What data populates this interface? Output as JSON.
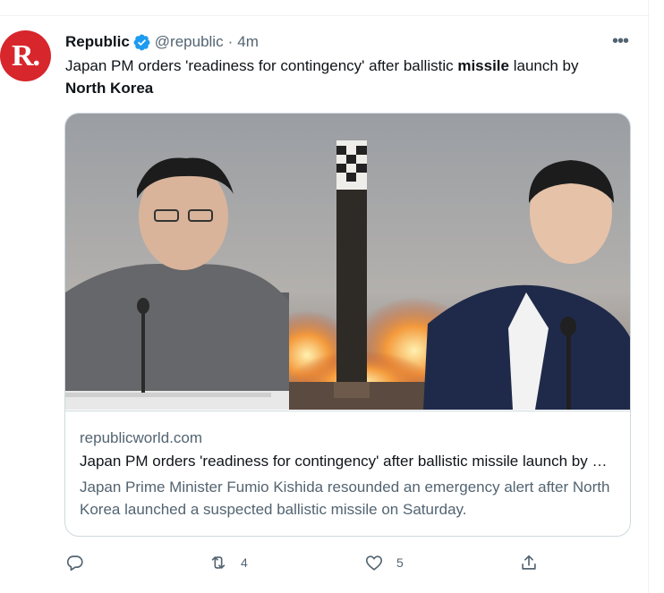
{
  "tweet": {
    "author_name": "Republic",
    "author_handle": "@republic",
    "separator": "·",
    "time": "4m",
    "avatar_letter": "R.",
    "text": {
      "part1": "Japan PM orders 'readiness for contingency' after ballistic ",
      "bold1": "missile",
      "part2": " launch by ",
      "bold2": "North Korea"
    },
    "card": {
      "domain": "republicworld.com",
      "title": "Japan PM orders 'readiness for contingency' after ballistic missile launch by North Korea",
      "description": "Japan Prime Minister Fumio Kishida resounded an emergency alert after North Korea launched a suspected ballistic missile on Saturday."
    },
    "actions": {
      "reply_count": "",
      "retweet_count": "4",
      "like_count": "5"
    }
  },
  "colors": {
    "brand_red": "#d7262c",
    "verified_blue": "#1d9bf0",
    "secondary_text": "#536471"
  },
  "icons": [
    "verified-badge-icon",
    "more-icon",
    "reply-icon",
    "retweet-icon",
    "like-icon",
    "share-icon"
  ]
}
